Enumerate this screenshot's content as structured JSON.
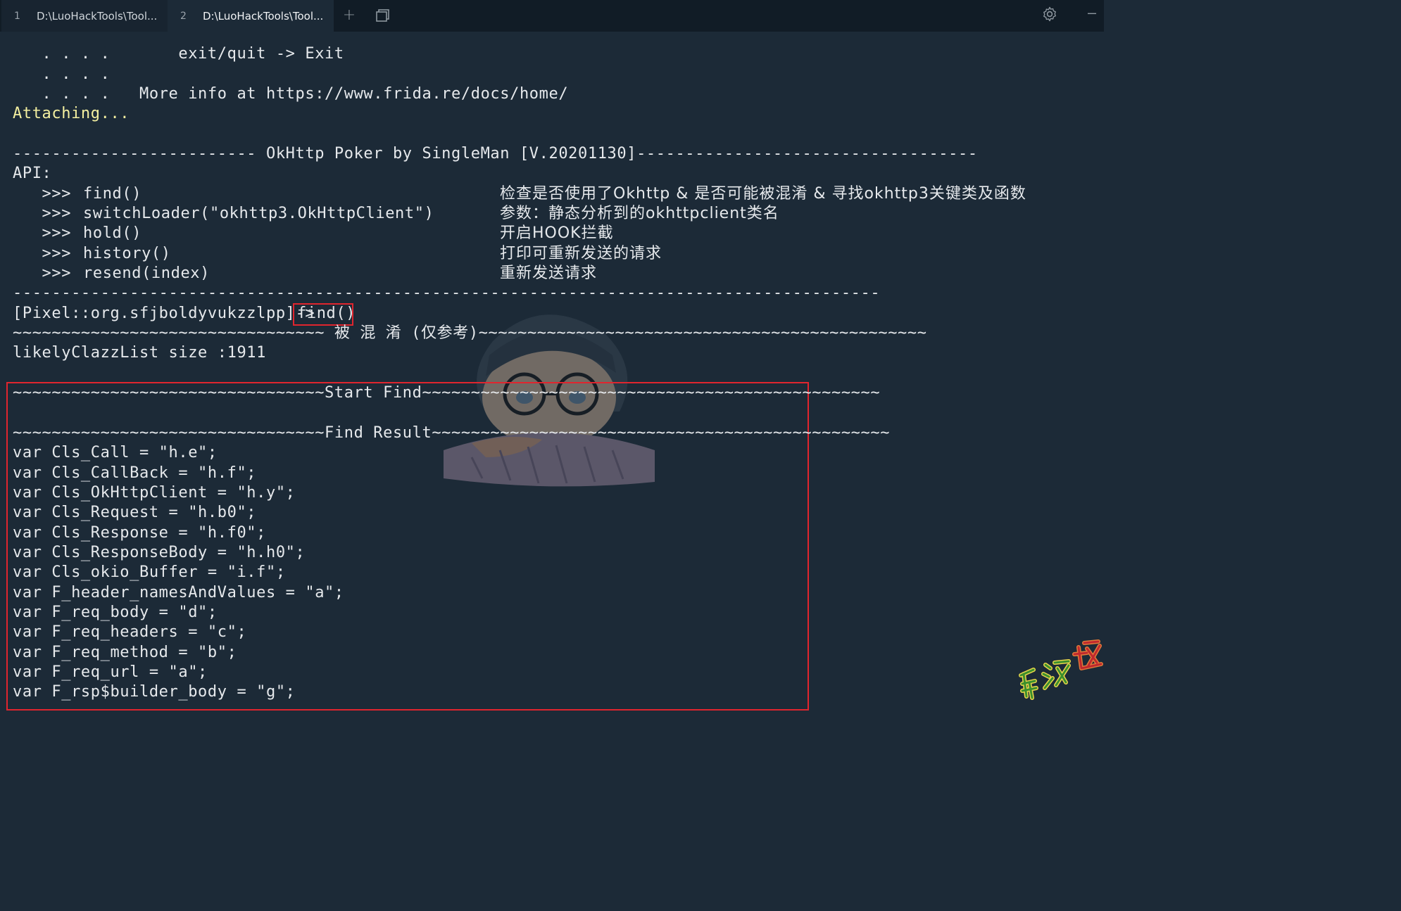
{
  "tabs": [
    {
      "number": "1",
      "title": "D:\\LuoHackTools\\Tool..."
    },
    {
      "number": "2",
      "title": "D:\\LuoHackTools\\Tool..."
    }
  ],
  "icons": {
    "new_tab": "plus-icon",
    "tab_menu": "window-icon",
    "settings": "gear-icon",
    "minimize": "minimize-icon"
  },
  "terminal": {
    "banner_1": "   . . . .       exit/quit -> Exit",
    "banner_2": "   . . . .",
    "banner_3": "   . . . .   More info at https://www.frida.re/docs/home/",
    "attaching": "Attaching...",
    "header": "------------------------- OkHttp Poker by SingleMan [V.20201130]-----------------------------------",
    "api_label": "API:",
    "api": [
      {
        "prompt": "   >>>",
        "call": "find()",
        "desc": "检查是否使用了Okhttp & 是否可能被混淆 & 寻找okhttp3关键类及函数"
      },
      {
        "prompt": "   >>>",
        "call": "switchLoader(\"okhttp3.OkHttpClient\")",
        "desc": "参数：静态分析到的okhttpclient类名"
      },
      {
        "prompt": "   >>>",
        "call": "hold()",
        "desc": "开启HOOK拦截"
      },
      {
        "prompt": "   >>>",
        "call": "history()",
        "desc": "打印可重新发送的请求"
      },
      {
        "prompt": "   >>>",
        "call": "resend(index)",
        "desc": "重新发送请求"
      }
    ],
    "separator": "-----------------------------------------------------------------------------------------",
    "prompt": "[Pixel::org.sfjboldyvukzzlpp]->",
    "command": "find()",
    "obfuscated_line": "~~~~~~~~~~~~~~~~~~~~~~~~~~~~~~~~ 被 混 淆 (仅参考)~~~~~~~~~~~~~~~~~~~~~~~~~~~~~~~~~~~~~~~~~~~~~~",
    "likely_size": "likelyClazzList size :1911",
    "start_find": "~~~~~~~~~~~~~~~~~~~~~~~~~~~~~~~~Start Find~~~~~~~~~~~~~~~~~~~~~~~~~~~~~~~~~~~~~~~~~~~~~~~",
    "find_result": "~~~~~~~~~~~~~~~~~~~~~~~~~~~~~~~~Find Result~~~~~~~~~~~~~~~~~~~~~~~~~~~~~~~~~~~~~~~~~~~~~~~",
    "results": [
      "var Cls_Call = \"h.e\";",
      "var Cls_CallBack = \"h.f\";",
      "var Cls_OkHttpClient = \"h.y\";",
      "var Cls_Request = \"h.b0\";",
      "var Cls_Response = \"h.f0\";",
      "var Cls_ResponseBody = \"h.h0\";",
      "var Cls_okio_Buffer = \"i.f\";",
      "var F_header_namesAndValues = \"a\";",
      "var F_req_body = \"d\";",
      "var F_req_headers = \"c\";",
      "var F_req_method = \"b\";",
      "var F_req_url = \"a\";",
      "var F_rsp$builder_body = \"g\";"
    ]
  },
  "colors": {
    "background": "#1c2a37",
    "tabbar": "#111c26",
    "text": "#e6e9ec",
    "attaching": "#f3efa0",
    "highlight_box": "#e0252e"
  }
}
